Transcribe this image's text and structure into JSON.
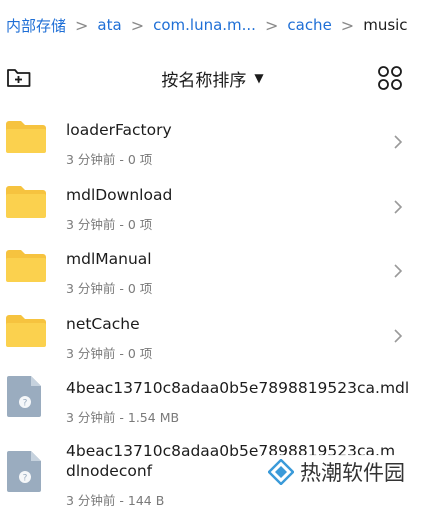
{
  "breadcrumb": {
    "items": [
      "内部存储",
      "ata",
      "com.luna.m...",
      "cache",
      "music"
    ]
  },
  "toolbar": {
    "sort_label": "按名称排序",
    "new_folder_icon": "new-folder-icon",
    "view_toggle_icon": "grid-view-icon"
  },
  "files": [
    {
      "name": "loaderFactory",
      "meta": "3 分钟前 - 0 项",
      "type": "folder"
    },
    {
      "name": "mdlDownload",
      "meta": "3 分钟前 - 0 项",
      "type": "folder"
    },
    {
      "name": "mdlManual",
      "meta": "3 分钟前 - 0 项",
      "type": "folder"
    },
    {
      "name": "netCache",
      "meta": "3 分钟前 - 0 项",
      "type": "folder"
    },
    {
      "name": "4beac13710c8adaa0b5e7898819523ca.mdl",
      "meta": "3 分钟前 - 1.54 MB",
      "type": "file"
    },
    {
      "name": "4beac13710c8adaa0b5e7898819523ca.mdlnodeconf",
      "meta": "3 分钟前 - 144 B",
      "type": "file"
    }
  ],
  "watermark": {
    "text": "热潮软件园"
  },
  "colors": {
    "link": "#1f6fd6",
    "folder": "#f6c33f",
    "file_icon": "#9aacbf"
  }
}
